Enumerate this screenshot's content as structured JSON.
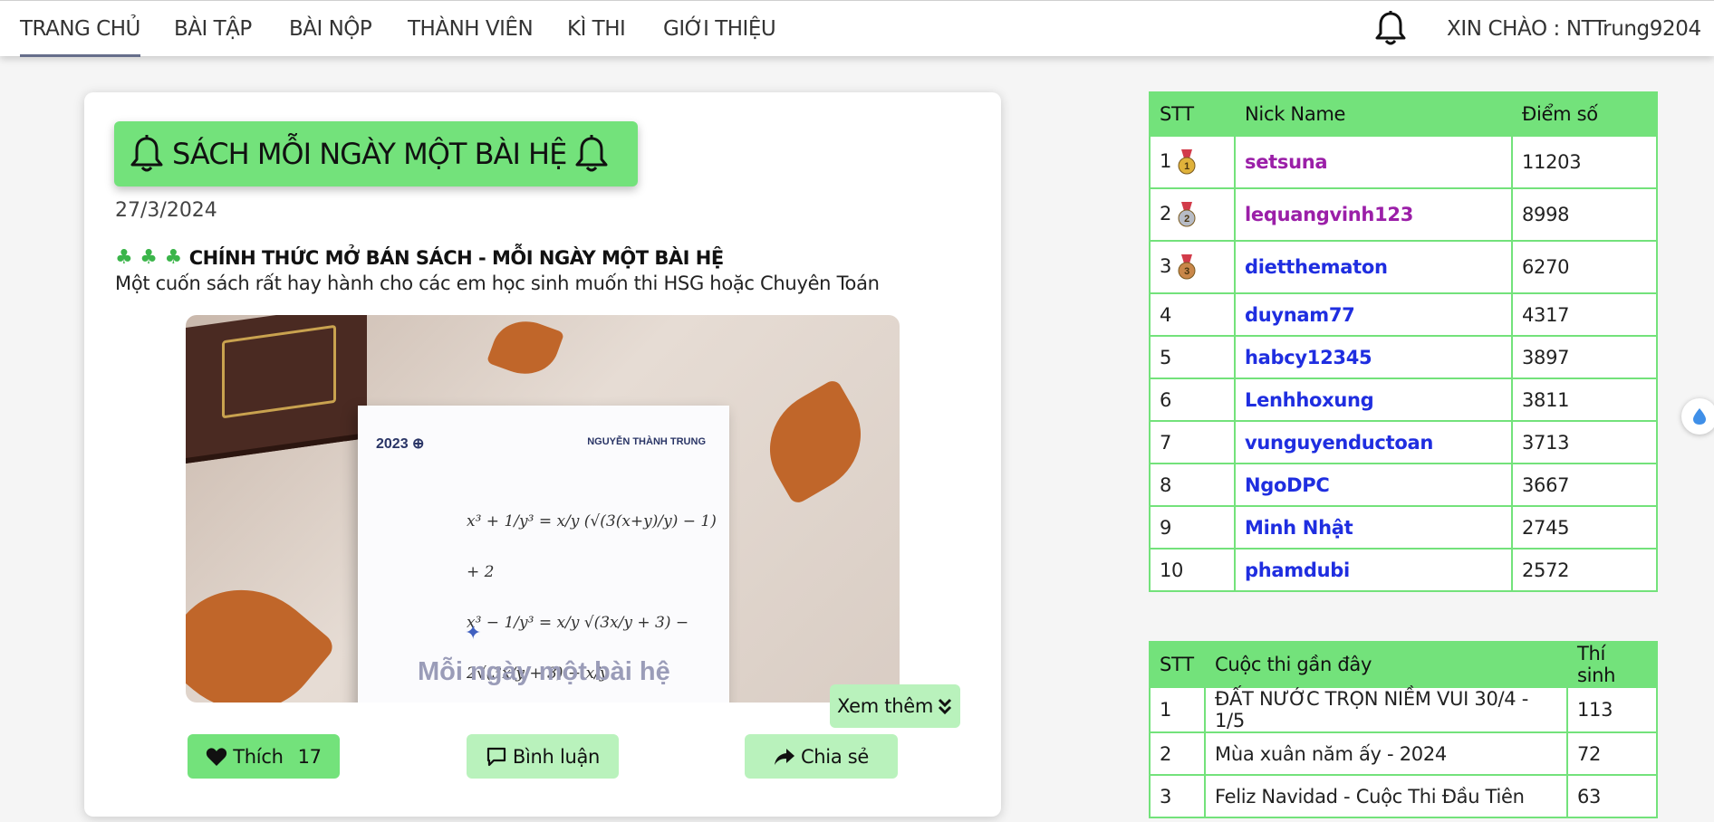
{
  "nav": {
    "items": [
      "TRANG CHỦ",
      "BÀI TẬP",
      "BÀI NỘP",
      "THÀNH VIÊN",
      "KÌ THI",
      "GIỚI THIỆU"
    ],
    "greeting": "XIN CHÀO : NTTrung9204"
  },
  "post": {
    "title": "SÁCH MỖI NGÀY MỘT BÀI HỆ",
    "date": "27/3/2024",
    "headline": "CHÍNH THỨC MỞ BÁN SÁCH - MỖI NGÀY MỘT BÀI HỆ",
    "description": "Một cuốn sách rất hay hành cho các em học sinh muốn thi HSG hoặc Chuyên Toán",
    "image": {
      "year": "2023",
      "author": "NGUYỄN THÀNH TRUNG",
      "brand": "Mỗi ngày một bài hệ"
    },
    "see_more": "Xem thêm",
    "like_label": "Thích",
    "like_count": "17",
    "comment_label": "Bình luận",
    "share_label": "Chia sẻ"
  },
  "ranking": {
    "headers": [
      "STT",
      "Nick Name",
      "Điểm số"
    ],
    "rows": [
      {
        "stt": "1",
        "nick": "setsuna",
        "score": "11203",
        "medal": "gold",
        "color": "#9b1fa8"
      },
      {
        "stt": "2",
        "nick": "lequangvinh123",
        "score": "8998",
        "medal": "silver",
        "color": "#9b1fa8"
      },
      {
        "stt": "3",
        "nick": "dietthematon",
        "score": "6270",
        "medal": "bronze",
        "color": "#1f2ee0"
      },
      {
        "stt": "4",
        "nick": "duynam77",
        "score": "4317"
      },
      {
        "stt": "5",
        "nick": "habcy12345",
        "score": "3897"
      },
      {
        "stt": "6",
        "nick": "Lenhhoxung",
        "score": "3811"
      },
      {
        "stt": "7",
        "nick": "vunguyenductoan",
        "score": "3713"
      },
      {
        "stt": "8",
        "nick": "NgoDPC",
        "score": "3667"
      },
      {
        "stt": "9",
        "nick": "Minh Nhật",
        "score": "2745"
      },
      {
        "stt": "10",
        "nick": "phamdubi",
        "score": "2572"
      }
    ]
  },
  "contests": {
    "headers": [
      "STT",
      "Cuộc thi gần đây",
      "Thí sinh"
    ],
    "rows": [
      {
        "stt": "1",
        "name": "ĐẤT NƯỚC TRỌN NIỀM VUI 30/4 - 1/5",
        "count": "113"
      },
      {
        "stt": "2",
        "name": "Mùa xuân năm ấy - 2024",
        "count": "72"
      },
      {
        "stt": "3",
        "name": "Feliz Navidad - Cuộc Thi Đầu Tiên",
        "count": "63"
      }
    ]
  },
  "colors": {
    "accent_green": "#73e27b",
    "light_green": "#b9f2bc",
    "purple_nick": "#9b1fa8",
    "blue_nick": "#1f2ee0"
  },
  "icons": [
    "bell-icon",
    "heart-icon",
    "comment-icon",
    "share-icon",
    "chevron-double-down-icon",
    "medal-icon",
    "clover-icon",
    "water-drop-icon"
  ]
}
